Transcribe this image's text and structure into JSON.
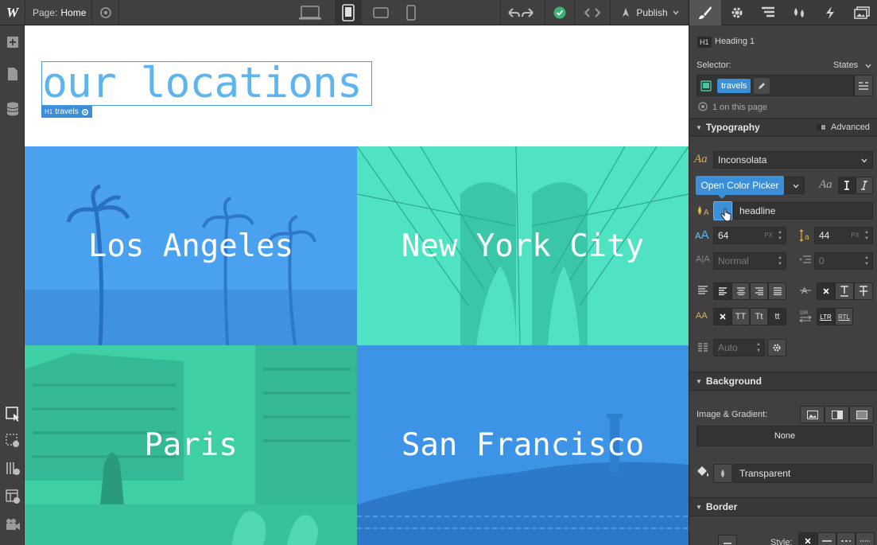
{
  "topbar": {
    "page_prefix": "Page:",
    "page_name": "Home",
    "publish_label": "Publish"
  },
  "canvas": {
    "heading": "our locations",
    "heading_tag": "H1",
    "heading_class": "travels",
    "tiles": [
      {
        "city": "Los Angeles",
        "color": "#4aa1ef"
      },
      {
        "city": "New York City",
        "color": "#4fe3c3"
      },
      {
        "city": "Paris",
        "color": "#3ecfa5"
      },
      {
        "city": "San Francisco",
        "color": "#3d93e6"
      }
    ]
  },
  "panel": {
    "element_tag": "H1",
    "element_name": "Heading 1",
    "selector_label": "Selector:",
    "states_label": "States",
    "selector_chip": "travels",
    "on_page": "1 on this page",
    "typography": {
      "title": "Typography",
      "advanced": "Advanced",
      "font": "Inconsolata",
      "font_aa": "Aa",
      "color_name": "headline",
      "font_size": "64",
      "font_size_unit": "PX",
      "line_height": "44",
      "line_height_unit": "PX",
      "letter_spacing": "Normal",
      "text_indent": "0",
      "columns": "Auto",
      "case_buttons": [
        "TT",
        "Tt",
        "tt"
      ],
      "dir_ltr": "LTR",
      "dir_rtl": "RTL"
    },
    "background": {
      "title": "Background",
      "image_gradient_label": "Image & Gradient:",
      "image_value": "None",
      "color_value": "Transparent"
    },
    "border": {
      "title": "Border",
      "style_label": "Style:"
    }
  },
  "tooltip": "Open Color Picker",
  "colors": {
    "accent": "#3b8fd9",
    "heading": "#5eb4ef",
    "panel_bg": "#404040"
  }
}
